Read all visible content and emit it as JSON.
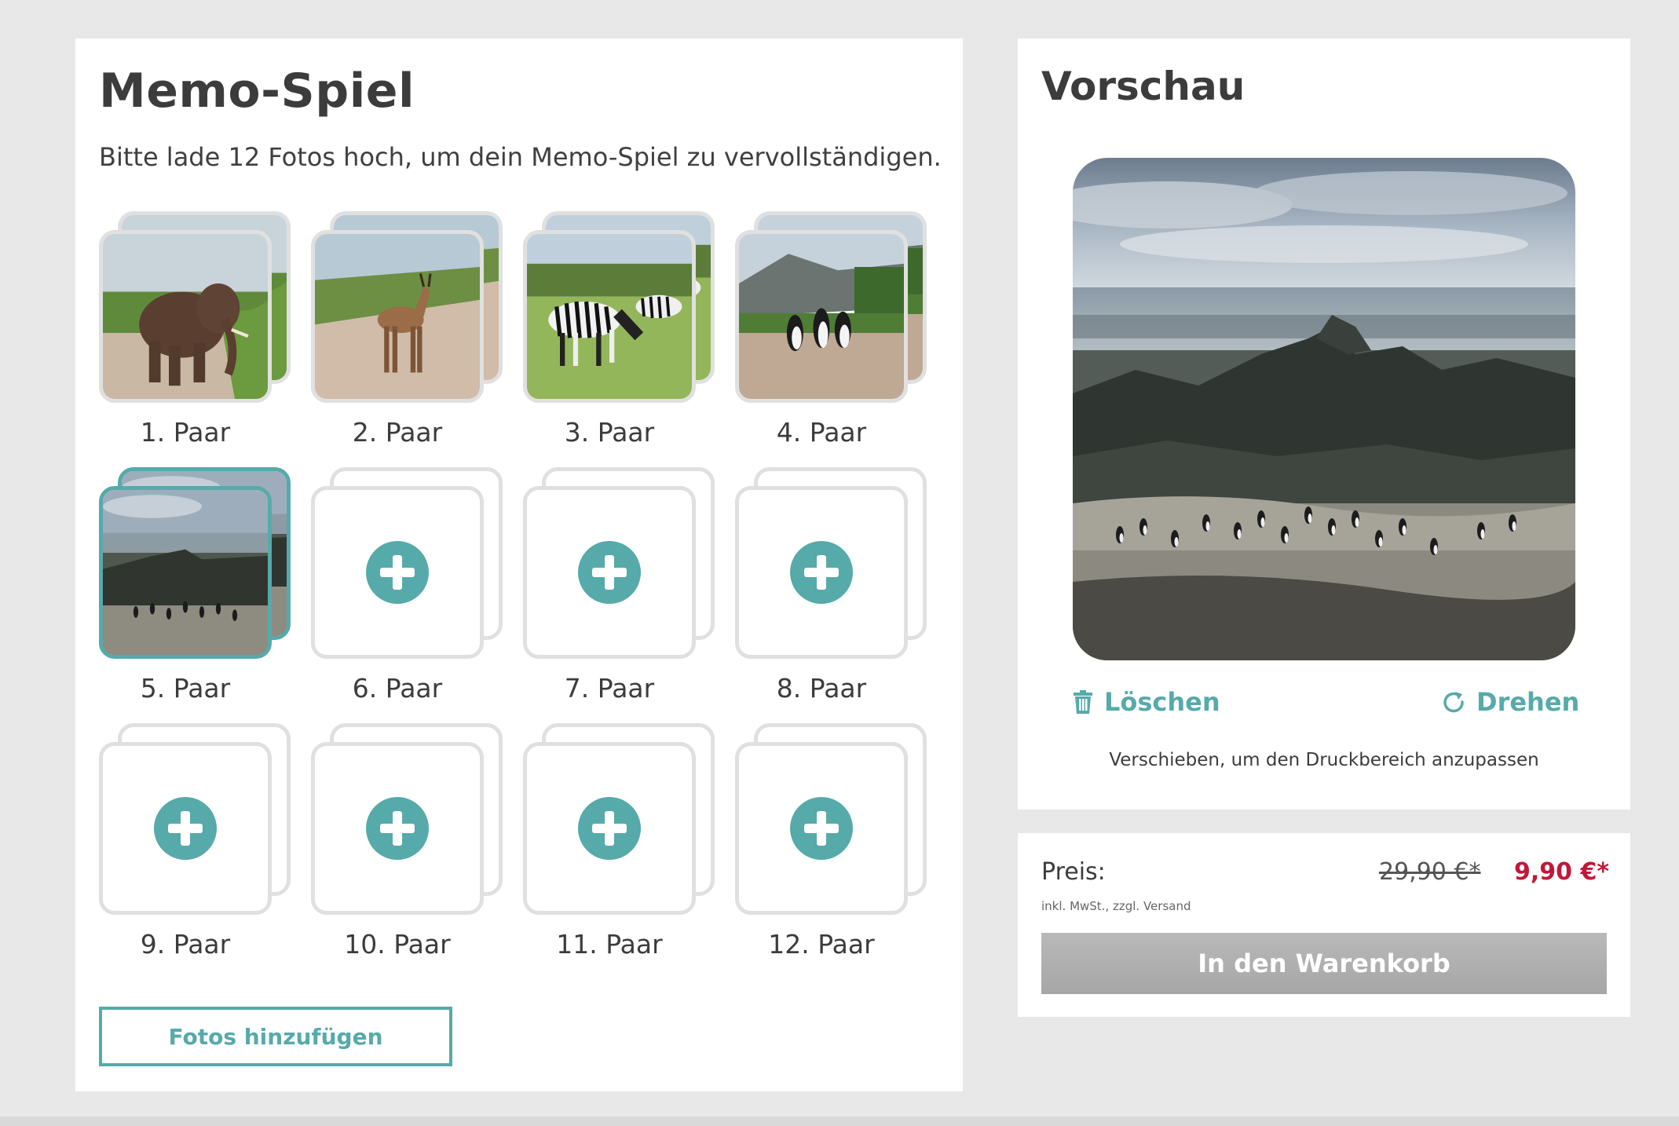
{
  "left_panel": {
    "title": "Memo-Spiel",
    "subtitle": "Bitte lade 12 Fotos hoch, um dein Memo-Spiel zu vervollständigen.",
    "pairs": [
      {
        "label": "1. Paar",
        "photo": "elephant"
      },
      {
        "label": "2. Paar",
        "photo": "antelope"
      },
      {
        "label": "3. Paar",
        "photo": "zebras"
      },
      {
        "label": "4. Paar",
        "photo": "penguins-road"
      },
      {
        "label": "5. Paar",
        "photo": "penguins-coast"
      },
      {
        "label": "6. Paar",
        "photo": null
      },
      {
        "label": "7. Paar",
        "photo": null
      },
      {
        "label": "8. Paar",
        "photo": null
      },
      {
        "label": "9. Paar",
        "photo": null
      },
      {
        "label": "10. Paar",
        "photo": null
      },
      {
        "label": "11. Paar",
        "photo": null
      },
      {
        "label": "12. Paar",
        "photo": null
      }
    ],
    "selected_pair": 5,
    "add_photos_label": "Fotos hinzufügen"
  },
  "preview": {
    "title": "Vorschau",
    "delete_label": "Löschen",
    "rotate_label": "Drehen",
    "hint": "Verschieben, um den Druckbereich anzupassen",
    "delete_icon": "trash-icon",
    "rotate_icon": "rotate-icon"
  },
  "price": {
    "label": "Preis:",
    "note": "inkl. MwSt., zzgl. Versand",
    "old_price": "29,90 €*",
    "new_price": "9,90 €*",
    "cart_label": "In den Warenkorb"
  },
  "colors": {
    "accent": "#56aaaa",
    "sale": "#c1183a",
    "panel": "#ffffff",
    "page_bg": "#e8e8e8",
    "disabled_button": "#b0b0b0"
  }
}
